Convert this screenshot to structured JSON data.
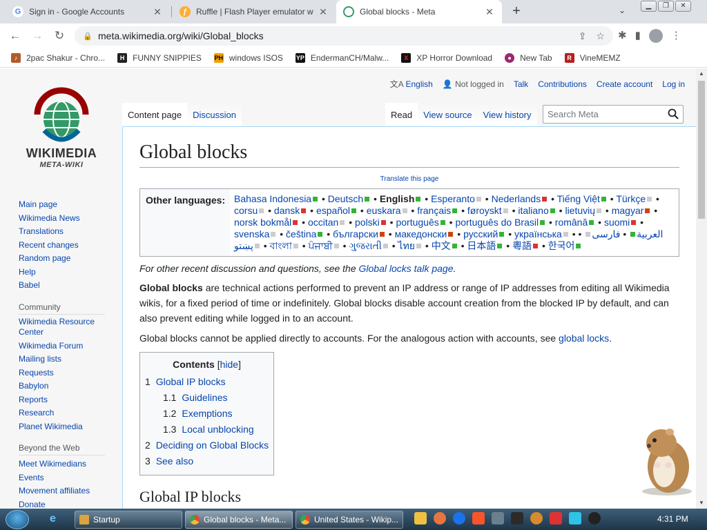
{
  "browser": {
    "tabs": [
      {
        "title": "Sign in - Google Accounts",
        "icon": "google-icon",
        "active": false
      },
      {
        "title": "Ruffle | Flash Player emulator wri",
        "icon": "ruffle-icon",
        "active": false
      },
      {
        "title": "Global blocks - Meta",
        "icon": "wikimedia-icon",
        "active": true
      }
    ],
    "url": "meta.wikimedia.org/wiki/Global_blocks",
    "bookmarks": [
      {
        "label": "2pac Shakur - Chro...",
        "color": "#b35a2a",
        "glyph": "♪"
      },
      {
        "label": "FUNNY SNIPPIES",
        "color": "#222222",
        "glyph": "H"
      },
      {
        "label": "windows ISOS",
        "color": "#f0a000",
        "glyph": "PH"
      },
      {
        "label": "EndermanCH/Malw...",
        "color": "#111111",
        "glyph": "YP"
      },
      {
        "label": "XP Horror Download",
        "color": "#111111",
        "glyph": "X"
      },
      {
        "label": "New Tab",
        "color": "#9a2a6e",
        "glyph": "●"
      },
      {
        "label": "VineMEMZ",
        "color": "#b3201e",
        "glyph": "R"
      }
    ]
  },
  "wiki": {
    "logo_word": "WIKIMEDIA",
    "logo_sub": "META-WIKI",
    "personal": {
      "language": "English",
      "status": "Not logged in",
      "talk": "Talk",
      "contributions": "Contributions",
      "create": "Create account",
      "login": "Log in"
    },
    "tabs_left": [
      "Content page",
      "Discussion"
    ],
    "tabs_right": [
      "Read",
      "View source",
      "View history"
    ],
    "search_placeholder": "Search Meta",
    "sidebar": {
      "main": [
        "Main page",
        "Wikimedia News",
        "Translations",
        "Recent changes",
        "Random page",
        "Help",
        "Babel"
      ],
      "community_heading": "Community",
      "community": [
        "Wikimedia Resource Center",
        "Wikimedia Forum",
        "Mailing lists",
        "Requests",
        "Babylon",
        "Reports",
        "Research",
        "Planet Wikimedia"
      ],
      "beyond_heading": "Beyond the Web",
      "beyond": [
        "Meet Wikimedians",
        "Events",
        "Movement affiliates",
        "Donate"
      ]
    },
    "page_title": "Global blocks",
    "translate_link": "Translate this page",
    "other_languages_label": "Other languages:",
    "languages": [
      {
        "name": "Bahasa Indonesia",
        "mark": "g"
      },
      {
        "name": "Deutsch",
        "mark": "g"
      },
      {
        "name": "English",
        "mark": "g",
        "bold": true
      },
      {
        "name": "Esperanto",
        "mark": "gr"
      },
      {
        "name": "Nederlands",
        "mark": "r"
      },
      {
        "name": "Tiếng Việt",
        "mark": "g"
      },
      {
        "name": "Türkçe",
        "mark": "gr"
      },
      {
        "name": "corsu",
        "mark": "gr"
      },
      {
        "name": "dansk",
        "mark": "r"
      },
      {
        "name": "español",
        "mark": "g"
      },
      {
        "name": "euskara",
        "mark": "gr"
      },
      {
        "name": "français",
        "mark": "g"
      },
      {
        "name": "føroyskt",
        "mark": "gr"
      },
      {
        "name": "italiano",
        "mark": "g"
      },
      {
        "name": "lietuvių",
        "mark": "gr"
      },
      {
        "name": "magyar",
        "mark": "p"
      },
      {
        "name": "norsk bokmål",
        "mark": "r"
      },
      {
        "name": "occitan",
        "mark": "gr"
      },
      {
        "name": "polski",
        "mark": "r"
      },
      {
        "name": "português",
        "mark": "g"
      },
      {
        "name": "português do Brasil",
        "mark": "g"
      },
      {
        "name": "română",
        "mark": "g"
      },
      {
        "name": "suomi",
        "mark": "r"
      },
      {
        "name": "svenska",
        "mark": "gr"
      },
      {
        "name": "čeština",
        "mark": "g"
      },
      {
        "name": "български",
        "mark": "p"
      },
      {
        "name": "македонски",
        "mark": "p"
      },
      {
        "name": "русский",
        "mark": "g"
      },
      {
        "name": "українська",
        "mark": "gr"
      },
      {
        "name": "العربية",
        "mark": "g"
      },
      {
        "name": "فارسی",
        "mark": "gr"
      },
      {
        "name": "پښتو",
        "mark": "gr"
      },
      {
        "name": "বাংলা",
        "mark": "gr"
      },
      {
        "name": "ਪੰਜਾਬੀ",
        "mark": "gr"
      },
      {
        "name": "ગુજરાતી",
        "mark": "gr"
      },
      {
        "name": "ไทย",
        "mark": "gr"
      },
      {
        "name": "中文",
        "mark": "g"
      },
      {
        "name": "日本語",
        "mark": "g"
      },
      {
        "name": "粵語",
        "mark": "r"
      },
      {
        "name": "한국어",
        "mark": "g"
      }
    ],
    "note_prefix": "For other recent discussion and questions, see the ",
    "note_link": "Global locks talk page",
    "note_suffix": ".",
    "para1_bold": "Global blocks",
    "para1_rest": " are technical actions performed to prevent an IP address or range of IP addresses from editing all Wikimedia wikis, for a fixed period of time or indefinitely. Global blocks disable account creation from the blocked IP by default, and can also prevent editing while logged in to an account.",
    "para2_text": "Global blocks cannot be applied directly to accounts. For the analogous action with accounts, see ",
    "para2_link": "global locks",
    "para2_end": ".",
    "toc": {
      "title": "Contents",
      "hide": "hide",
      "items": [
        {
          "num": "1",
          "label": "Global IP blocks",
          "level": 1
        },
        {
          "num": "1.1",
          "label": "Guidelines",
          "level": 2
        },
        {
          "num": "1.2",
          "label": "Exemptions",
          "level": 2
        },
        {
          "num": "1.3",
          "label": "Local unblocking",
          "level": 2
        },
        {
          "num": "2",
          "label": "Deciding on Global Blocks",
          "level": 1
        },
        {
          "num": "3",
          "label": "See also",
          "level": 1
        }
      ]
    },
    "next_heading": "Global IP blocks"
  },
  "taskbar": {
    "buttons": [
      {
        "label": "Startup",
        "color": "#d9a441"
      },
      {
        "label": "Global blocks - Meta...",
        "color": "#e8453c"
      },
      {
        "label": "United States - Wikip...",
        "color": "#e8453c"
      }
    ],
    "clock": "4:31 PM"
  }
}
